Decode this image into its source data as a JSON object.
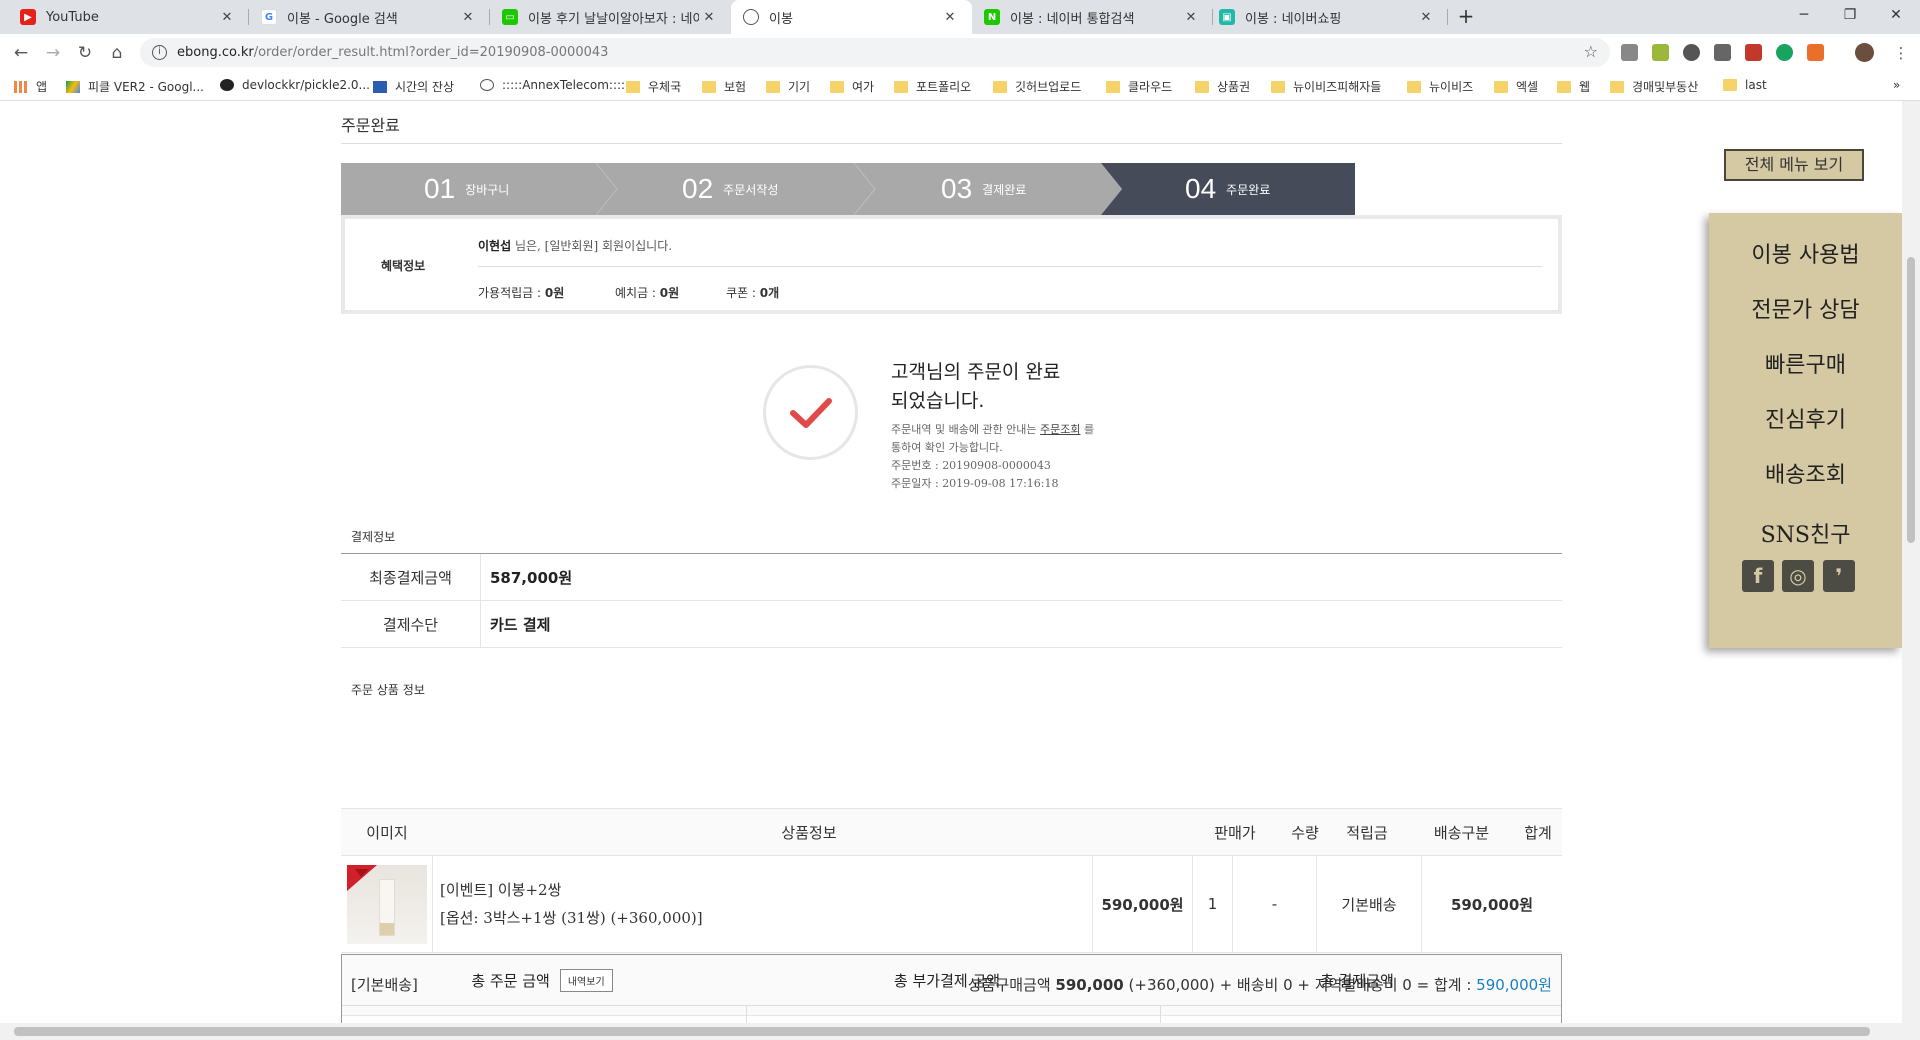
{
  "browser": {
    "tabs": [
      {
        "title": "YouTube",
        "icon": "youtube-icon"
      },
      {
        "title": "이봉 - Google 검색",
        "icon": "google-icon"
      },
      {
        "title": "이봉 후기 날날이알아보자 : 네이",
        "icon": "line-icon"
      },
      {
        "title": "이봉",
        "icon": "globe-icon"
      },
      {
        "title": "이봉 : 네이버 통합검색",
        "icon": "naver-icon"
      },
      {
        "title": "이봉 : 네이버쇼핑",
        "icon": "naver-shopping-icon"
      }
    ],
    "url_host": "ebong.co.kr",
    "url_path": "/order/order_result.html?order_id=20190908-0000043",
    "bookmarks": [
      "앱",
      "피클 VER2 - Googl...",
      "devlockkr/pickle2.0...",
      "시간의 잔상",
      ":::::AnnexTelecom:::::",
      "우체국",
      "보험",
      "기기",
      "여가",
      "포트폴리오",
      "깃허브업로드",
      "클라우드",
      "상품권",
      "뉴이비즈피해자들",
      "뉴이비즈",
      "엑셀",
      "웹",
      "경매및부동산",
      "last"
    ]
  },
  "page": {
    "title": "주문완료",
    "steps": [
      {
        "num": "01",
        "label": "장바구니"
      },
      {
        "num": "02",
        "label": "주문서작성"
      },
      {
        "num": "03",
        "label": "결제완료"
      },
      {
        "num": "04",
        "label": "주문완료"
      }
    ],
    "benefit": {
      "label": "혜택정보",
      "member_name": "이현섭",
      "member_suffix": "님은, [일반회원] 회원이십니다.",
      "points_label": "가용적립금 : ",
      "points_value": "0원",
      "deposit_label": "예치금 : ",
      "deposit_value": "0원",
      "coupon_label": "쿠폰 : ",
      "coupon_value": "0개"
    },
    "complete": {
      "heading_line1": "고객님의 주문이 완료",
      "heading_line2": "되었습니다.",
      "info_prefix": "주문내역 및 배송에 관한 안내는 ",
      "info_link": "주문조회",
      "info_suffix": " 를",
      "info_line2": "통하여 확인 가능합니다.",
      "order_no_label": "주문번호 : ",
      "order_no": "20190908-0000043",
      "order_date_label": "주문일자 : ",
      "order_date": "2019-09-08 17:16:18"
    },
    "payment": {
      "section_label": "결제정보",
      "final_label": "최종결제금액",
      "final_value": "587,000원",
      "method_label": "결제수단",
      "method_value": "카드 결제"
    },
    "products": {
      "section_label": "주문 상품 정보",
      "headers": [
        "이미지",
        "상품정보",
        "판매가",
        "수량",
        "적립금",
        "배송구분",
        "합계"
      ],
      "rows": [
        {
          "name": "[이벤트] 이봉+2쌍",
          "option": "[옵션: 3박스+1쌍 (31쌍) (+360,000)]",
          "price": "590,000원",
          "qty": "1",
          "points": "-",
          "shipping": "기본배송",
          "total": "590,000원"
        }
      ],
      "footer_left": "[기본배송]",
      "footer_prefix": "상품구매금액 ",
      "footer_amount": "590,000",
      "footer_rest": " (+360,000) + 배송비 0 + 지역별배송비 0 = 합계 : ",
      "footer_total": "590,000원"
    },
    "summary": {
      "total_order": "총 주문 금액",
      "detail_button": "내역보기",
      "total_extra": "총 부가결제 금액",
      "total_pay": "총 결제금액"
    },
    "side": {
      "full_menu": "전체 메뉴 보기",
      "items": [
        "이봉 사용법",
        "전문가 상담",
        "빠른구매",
        "진심후기",
        "배송조회",
        "SNS친구"
      ]
    }
  },
  "colors": {
    "step_inactive": "#a9a9a9",
    "step_active": "#454b58",
    "check_red": "#e04a4a",
    "side_bg": "#d4c9a2",
    "total_blue": "#1a7fc1"
  }
}
